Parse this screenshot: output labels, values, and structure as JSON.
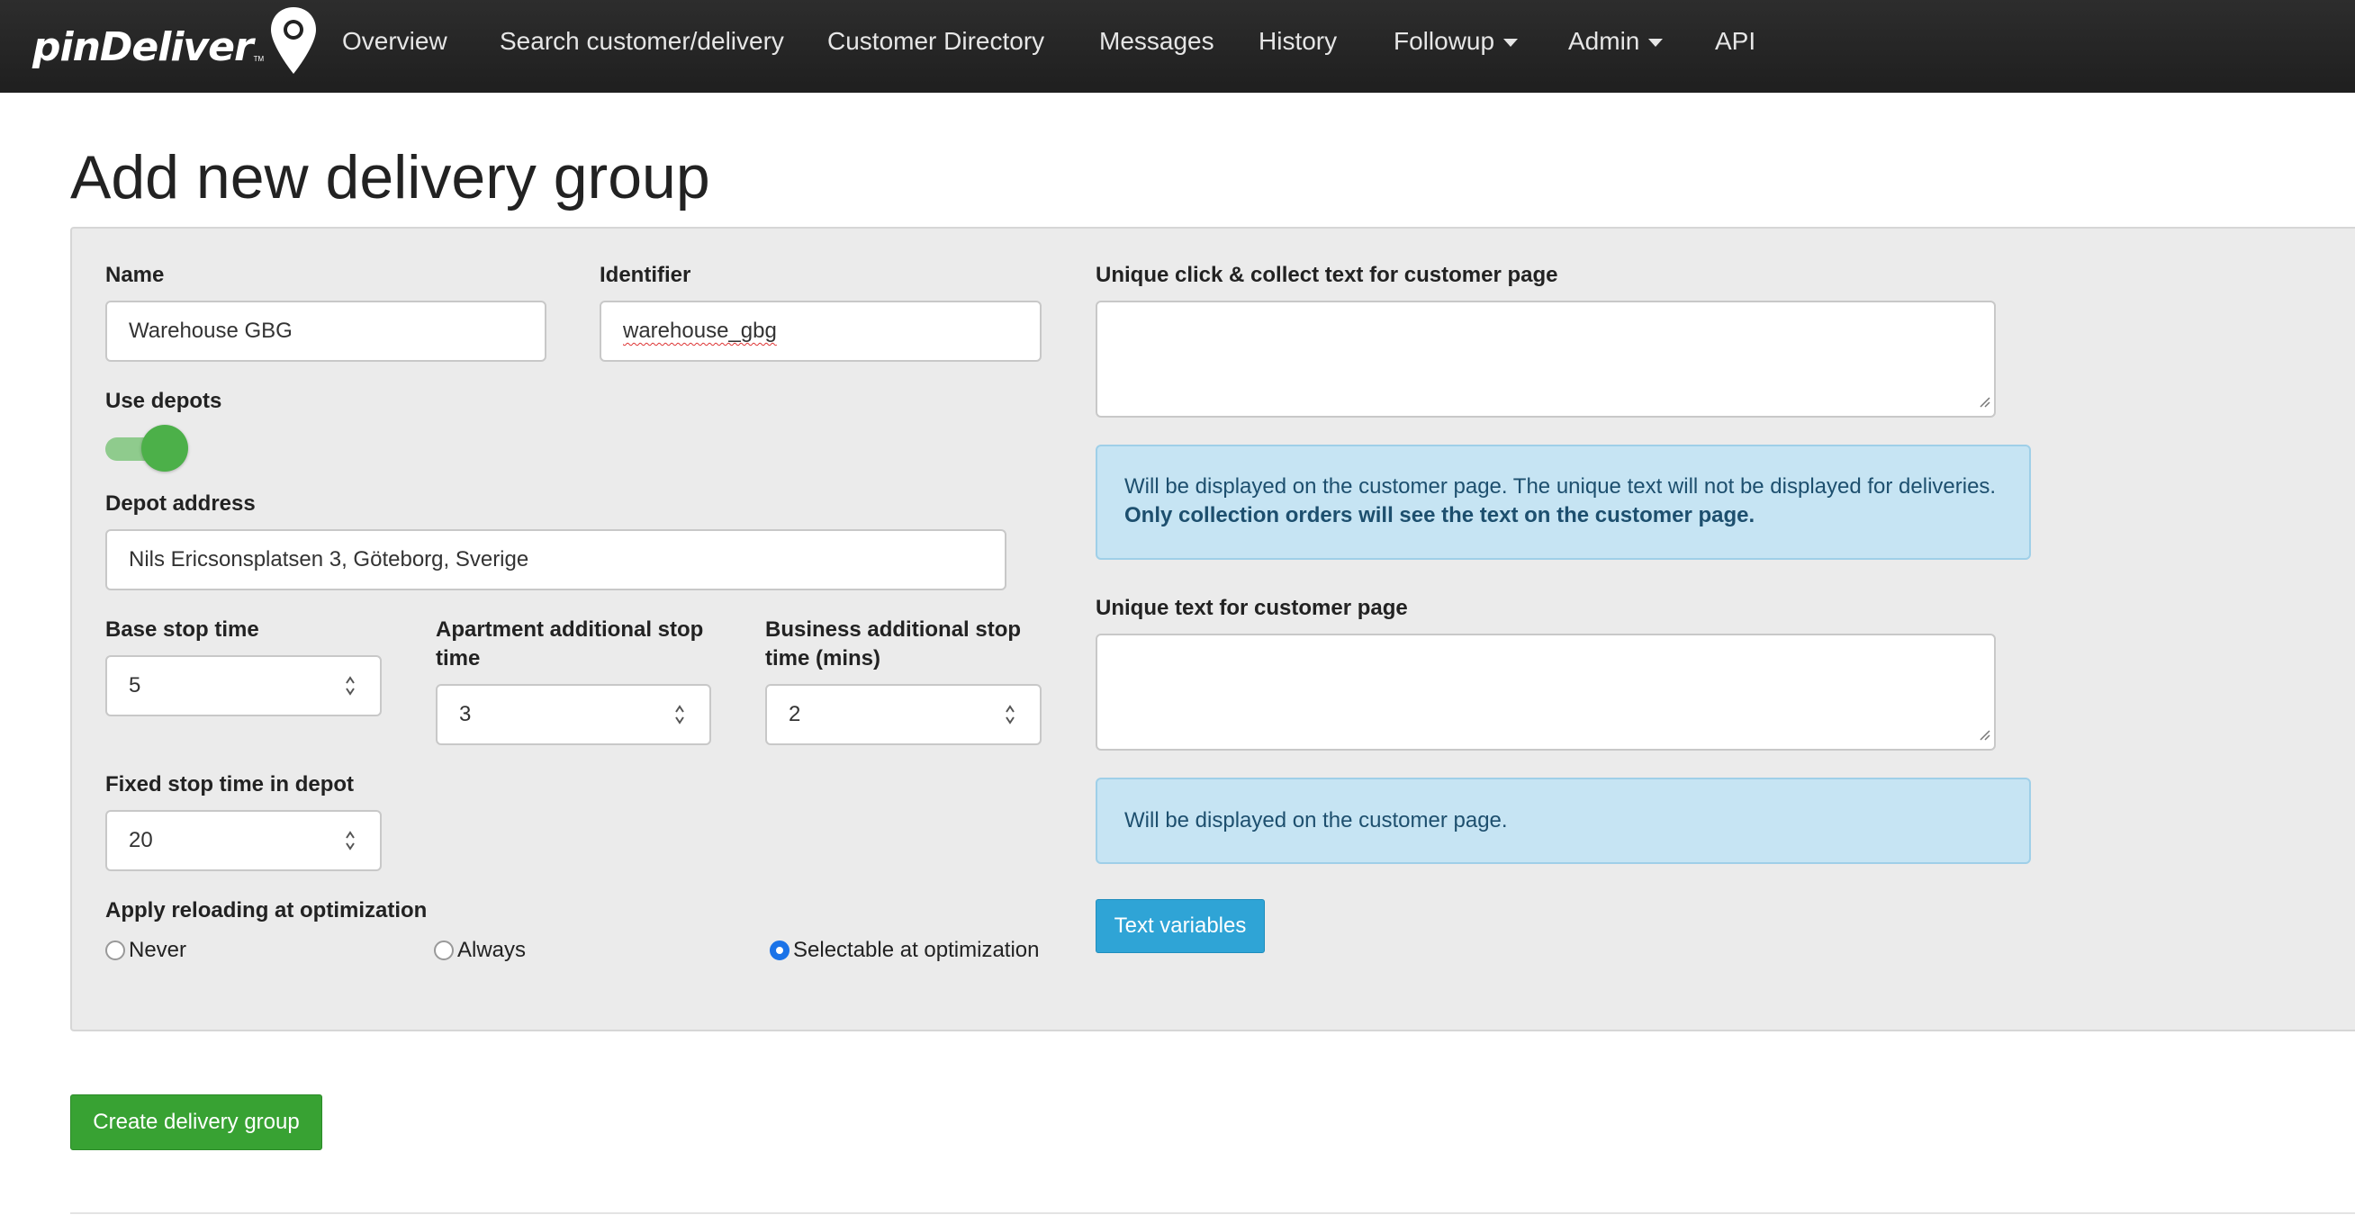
{
  "nav": {
    "brand": "pinDeliver",
    "brand_tm": "TM",
    "items": {
      "overview": "Overview",
      "search": "Search customer/delivery",
      "directory": "Customer Directory",
      "messages": "Messages",
      "history": "History",
      "followup": "Followup",
      "admin": "Admin",
      "api": "API"
    }
  },
  "page": {
    "title": "Add new delivery group"
  },
  "form": {
    "name": {
      "label": "Name",
      "value": "Warehouse GBG"
    },
    "identifier": {
      "label": "Identifier",
      "value": "warehouse_gbg"
    },
    "use_depots": {
      "label": "Use depots",
      "enabled": true
    },
    "depot_address": {
      "label": "Depot address",
      "value": "Nils Ericsonsplatsen 3, Göteborg, Sverige"
    },
    "base_stop_time": {
      "label": "Base stop time",
      "value": "5"
    },
    "apartment_stop_time": {
      "label_line1": "Apartment additional stop",
      "label_line2": "time",
      "value": "3"
    },
    "business_stop_time": {
      "label_line1": "Business additional stop",
      "label_line2": "time (mins)",
      "value": "2"
    },
    "fixed_depot_time": {
      "label": "Fixed stop time in depot",
      "value": "20"
    },
    "reloading": {
      "label": "Apply reloading at optimization",
      "options": {
        "never": "Never",
        "always": "Always",
        "selectable": "Selectable at optimization"
      },
      "selected": "selectable"
    },
    "click_collect_text": {
      "label": "Unique click & collect text for customer page",
      "value": "",
      "info_line1": "Will be displayed on the customer page. The unique text will not be displayed for deliveries.",
      "info_line2_bold": "Only collection orders will see the text on the customer page."
    },
    "customer_page_text": {
      "label": "Unique text for customer page",
      "value": "",
      "info": "Will be displayed on the customer page."
    },
    "text_variables_button": "Text variables",
    "create_button": "Create delivery group"
  },
  "colors": {
    "navbar": "#222222",
    "toggle_on": "#4cb049",
    "info_bg": "#c6e4f3",
    "text_variables_btn": "#2fa4d6",
    "create_btn": "#38a233",
    "radio_checked": "#1a73e8"
  },
  "icons": {
    "brand_pin": "map-pin-icon",
    "caret": "caret-down-icon",
    "spinner": "number-spinner-icon",
    "resize": "resize-grip-icon"
  }
}
